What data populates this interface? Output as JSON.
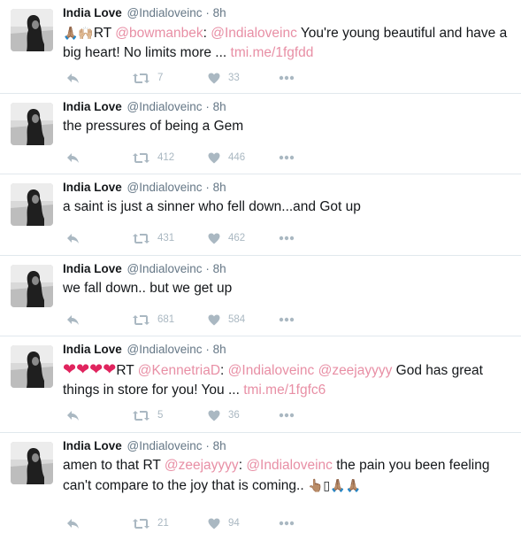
{
  "colors": {
    "link": "#e88fa5",
    "meta": "#657786",
    "icon": "#aab8c2",
    "divider": "#e1e8ed"
  },
  "tweets": [
    {
      "name": "India Love",
      "handle": "@Indialoveinc",
      "dot": "·",
      "time": "8h",
      "emojis_prefix": "🙏🏽🙌🏼",
      "text_parts": [
        {
          "t": "RT ",
          "link": false
        },
        {
          "t": "@bowmanbek",
          "link": true
        },
        {
          "t": ": ",
          "link": false
        },
        {
          "t": "@Indialoveinc",
          "link": true
        },
        {
          "t": " You're young beautiful and have a big heart! No limits more ... ",
          "link": false
        },
        {
          "t": "tmi.me/1fgfdd",
          "link": true
        }
      ],
      "retweets": "7",
      "likes": "33"
    },
    {
      "name": "India Love",
      "handle": "@Indialoveinc",
      "dot": "·",
      "time": "8h",
      "text": "the pressures of being a Gem",
      "retweets": "412",
      "likes": "446"
    },
    {
      "name": "India Love",
      "handle": "@Indialoveinc",
      "dot": "·",
      "time": "8h",
      "text": "a saint is just a sinner who fell down...and Got up",
      "retweets": "431",
      "likes": "462"
    },
    {
      "name": "India Love",
      "handle": "@Indialoveinc",
      "dot": "·",
      "time": "8h",
      "text": "we fall down.. but we get up",
      "retweets": "681",
      "likes": "584"
    },
    {
      "name": "India Love",
      "handle": "@Indialoveinc",
      "dot": "·",
      "time": "8h",
      "hearts": "❤❤❤❤",
      "text_parts": [
        {
          "t": "RT ",
          "link": false
        },
        {
          "t": "@KennetriaD",
          "link": true
        },
        {
          "t": ": ",
          "link": false
        },
        {
          "t": "@Indialoveinc",
          "link": true
        },
        {
          "t": " ",
          "link": false
        },
        {
          "t": "@zeejayyyy",
          "link": true
        },
        {
          "t": " God has great things in store for you! You ... ",
          "link": false
        },
        {
          "t": "tmi.me/1fgfc6",
          "link": true
        }
      ],
      "retweets": "5",
      "likes": "36"
    },
    {
      "name": "India Love",
      "handle": "@Indialoveinc",
      "dot": "·",
      "time": "8h",
      "text_parts": [
        {
          "t": "amen to that RT ",
          "link": false
        },
        {
          "t": "@zeejayyyy",
          "link": true
        },
        {
          "t": ": ",
          "link": false
        },
        {
          "t": "@Indialoveinc",
          "link": true
        },
        {
          "t": " the pain you been feeling can't compare to the joy that is coming.. ",
          "link": false
        }
      ],
      "emojis_suffix": "👆🏽▯🙏🏽🙏🏽",
      "retweets": "21",
      "likes": "94"
    }
  ]
}
